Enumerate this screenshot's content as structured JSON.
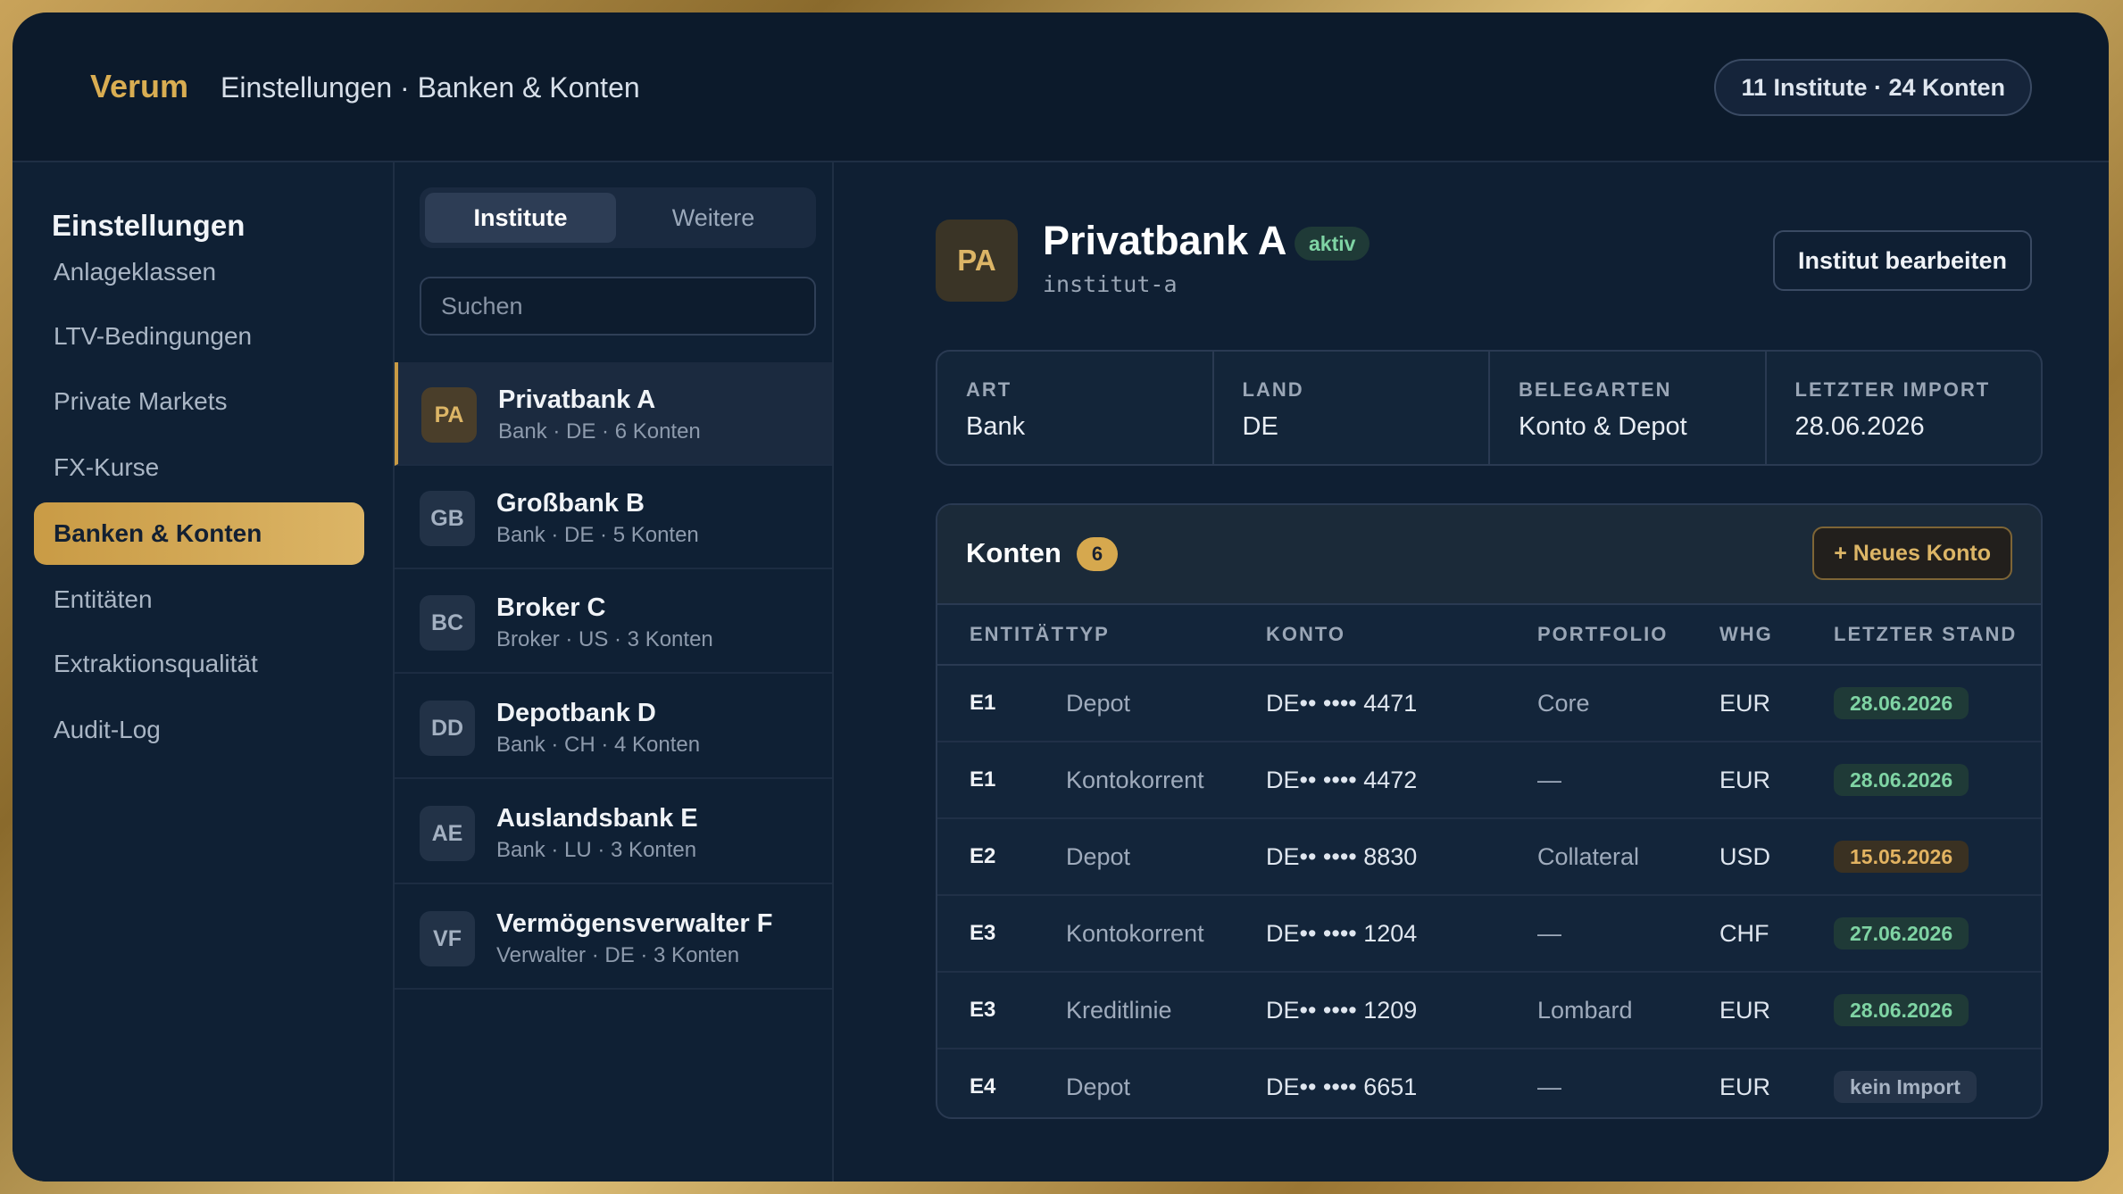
{
  "header": {
    "brand": "Verum",
    "breadcrumb": "Einstellungen · Banken & Konten",
    "summary": "11 Institute · 24 Konten"
  },
  "sidebar": {
    "title": "Einstellungen",
    "items": [
      {
        "label": "Anlageklassen"
      },
      {
        "label": "LTV-Bedingungen"
      },
      {
        "label": "Private Markets"
      },
      {
        "label": "FX-Kurse"
      },
      {
        "label": "Banken & Konten",
        "active": true
      },
      {
        "label": "Entitäten"
      },
      {
        "label": "Extraktionsqualität"
      },
      {
        "label": "Audit-Log"
      }
    ]
  },
  "list": {
    "tabs": [
      {
        "label": "Institute",
        "active": true
      },
      {
        "label": "Weitere"
      }
    ],
    "search_placeholder": "Suchen",
    "institutes": [
      {
        "initials": "PA",
        "name": "Privatbank A",
        "meta": "Bank · DE · 6 Konten",
        "active": true
      },
      {
        "initials": "GB",
        "name": "Großbank B",
        "meta": "Bank · DE · 5 Konten"
      },
      {
        "initials": "BC",
        "name": "Broker C",
        "meta": "Broker · US · 3 Konten"
      },
      {
        "initials": "DD",
        "name": "Depotbank D",
        "meta": "Bank · CH · 4 Konten"
      },
      {
        "initials": "AE",
        "name": "Auslandsbank E",
        "meta": "Bank · LU · 3 Konten"
      },
      {
        "initials": "VF",
        "name": "Vermögensverwalter F",
        "meta": "Verwalter · DE · 3 Konten"
      }
    ]
  },
  "detail": {
    "initials": "PA",
    "name": "Privatbank A",
    "status": "aktiv",
    "slug": "institut-a",
    "edit_label": "Institut bearbeiten",
    "info": [
      {
        "label": "ART",
        "value": "Bank"
      },
      {
        "label": "LAND",
        "value": "DE"
      },
      {
        "label": "BELEGARTEN",
        "value": "Konto & Depot"
      },
      {
        "label": "LETZTER IMPORT",
        "value": "28.06.2026"
      }
    ],
    "accounts_title": "Konten",
    "accounts_count": "6",
    "new_account_label": "+ Neues Konto",
    "columns": [
      "ENTITÄT",
      "TYP",
      "KONTO",
      "PORTFOLIO",
      "WHG",
      "LETZTER STAND"
    ],
    "rows": [
      {
        "entity": "E1",
        "type": "Depot",
        "account": "DE•• •••• 4471",
        "portfolio": "Core",
        "currency": "EUR",
        "last": "28.06.2026",
        "status": "green"
      },
      {
        "entity": "E1",
        "type": "Kontokorrent",
        "account": "DE•• •••• 4472",
        "portfolio": "—",
        "currency": "EUR",
        "last": "28.06.2026",
        "status": "green"
      },
      {
        "entity": "E2",
        "type": "Depot",
        "account": "DE•• •••• 8830",
        "portfolio": "Collateral",
        "currency": "USD",
        "last": "15.05.2026",
        "status": "amber"
      },
      {
        "entity": "E3",
        "type": "Kontokorrent",
        "account": "DE•• •••• 1204",
        "portfolio": "—",
        "currency": "CHF",
        "last": "27.06.2026",
        "status": "green"
      },
      {
        "entity": "E3",
        "type": "Kreditlinie",
        "account": "DE•• •••• 1209",
        "portfolio": "Lombard",
        "currency": "EUR",
        "last": "28.06.2026",
        "status": "green"
      },
      {
        "entity": "E4",
        "type": "Depot",
        "account": "DE•• •••• 6651",
        "portfolio": "—",
        "currency": "EUR",
        "last": "kein Import",
        "status": "none"
      }
    ]
  },
  "colors": {
    "accent": "#d9ad52",
    "background": "#0c1a2b",
    "success": "#7fd4a4",
    "warning": "#e2b361"
  }
}
